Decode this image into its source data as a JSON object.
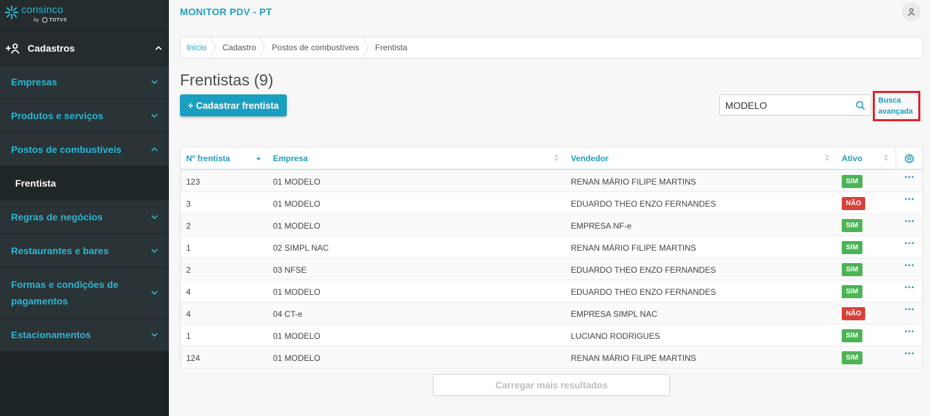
{
  "logo": {
    "name": "consinco",
    "by": "by",
    "partner": "TOTVS"
  },
  "sidebar": {
    "section": {
      "label": "Cadastros"
    },
    "items": [
      {
        "label": "Empresas"
      },
      {
        "label": "Produtos e serviços"
      },
      {
        "label": "Postos de combustíveis",
        "expanded": true
      },
      {
        "label": "Regras de negócios"
      },
      {
        "label": "Restaurantes e bares"
      },
      {
        "label": "Formas e condições de pagamentos"
      },
      {
        "label": "Estacionamentos"
      }
    ],
    "subitem": {
      "label": "Frentista"
    }
  },
  "header": {
    "title": "MONITOR PDV - PT"
  },
  "breadcrumb": [
    "Início",
    "Cadastro",
    "Postos de combustíveis",
    "Frentista"
  ],
  "page": {
    "title": "Frentistas (9)",
    "add_button": "+ Cadastrar frentista",
    "search_value": "MODELO",
    "advanced_search": "Busca avançada",
    "load_more": "Carregar mais resultados"
  },
  "table": {
    "columns": [
      "Nº frentista",
      "Empresa",
      "Vendedor",
      "Ativo"
    ],
    "rows": [
      {
        "numero": "123",
        "empresa": "01 MODELO",
        "vendedor": "RENAN MÁRIO FILIPE MARTINS",
        "ativo": "SIM"
      },
      {
        "numero": "3",
        "empresa": "01 MODELO",
        "vendedor": "EDUARDO THEO ENZO FERNANDES",
        "ativo": "NÃO"
      },
      {
        "numero": "2",
        "empresa": "01 MODELO",
        "vendedor": "EMPRESA NF-e",
        "ativo": "SIM"
      },
      {
        "numero": "1",
        "empresa": "02 SIMPL NAC",
        "vendedor": "RENAN MÁRIO FILIPE MARTINS",
        "ativo": "SIM"
      },
      {
        "numero": "2",
        "empresa": "03 NFSE",
        "vendedor": "EDUARDO THEO ENZO FERNANDES",
        "ativo": "SIM"
      },
      {
        "numero": "4",
        "empresa": "01 MODELO",
        "vendedor": "EDUARDO THEO ENZO FERNANDES",
        "ativo": "SIM"
      },
      {
        "numero": "4",
        "empresa": "04 CT-e",
        "vendedor": "EMPRESA SIMPL NAC",
        "ativo": "NÃO"
      },
      {
        "numero": "1",
        "empresa": "01 MODELO",
        "vendedor": "LUCIANO RODRIGUES",
        "ativo": "SIM"
      },
      {
        "numero": "124",
        "empresa": "01 MODELO",
        "vendedor": "RENAN MÁRIO FILIPE MARTINS",
        "ativo": "SIM"
      }
    ]
  },
  "colors": {
    "sidebar_bg": "#1d2426",
    "accent": "#1e9fbf",
    "active_badge": "#4cb454",
    "inactive_badge": "#d9403a",
    "highlight_border": "#e0202a"
  },
  "icons": [
    "user-plus-icon",
    "chevron-up-icon",
    "chevron-down-icon",
    "user-icon",
    "search-icon",
    "sort-icon",
    "gear-icon",
    "more-dots-icon"
  ]
}
